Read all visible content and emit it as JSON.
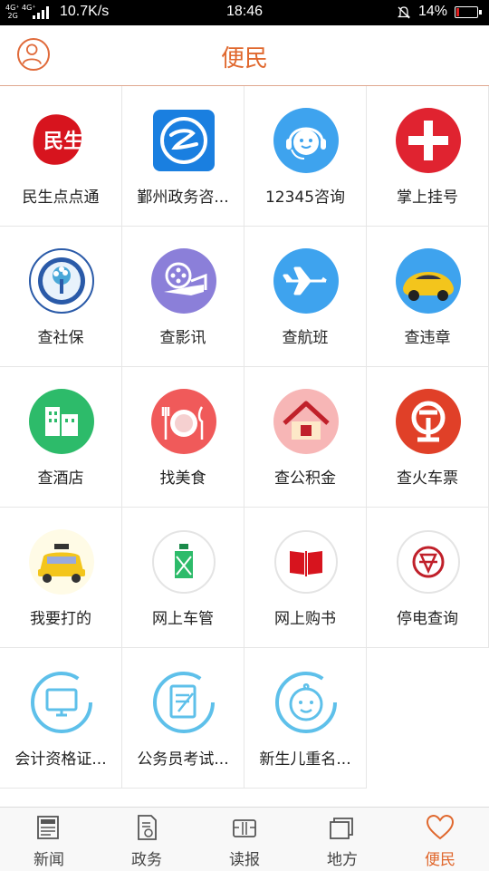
{
  "status_bar": {
    "network": "4G⁺ 4G⁺\n2G",
    "speed": "10.7K/s",
    "time": "18:46",
    "battery": "14%"
  },
  "header": {
    "title": "便民"
  },
  "services": [
    {
      "label": "民生点点通",
      "icon": "minsheng-logo-icon"
    },
    {
      "label": "鄞州政务咨...",
      "icon": "government-consult-icon"
    },
    {
      "label": "12345咨询",
      "icon": "headset-robot-icon"
    },
    {
      "label": "掌上挂号",
      "icon": "medical-cross-icon"
    },
    {
      "label": "查社保",
      "icon": "social-security-seal-icon"
    },
    {
      "label": "查影讯",
      "icon": "film-reel-icon"
    },
    {
      "label": "查航班",
      "icon": "airplane-icon"
    },
    {
      "label": "查违章",
      "icon": "yellow-car-icon"
    },
    {
      "label": "查酒店",
      "icon": "hotel-building-icon"
    },
    {
      "label": "找美食",
      "icon": "dining-plate-icon"
    },
    {
      "label": "查公积金",
      "icon": "house-icon"
    },
    {
      "label": "查火车票",
      "icon": "railway-logo-icon"
    },
    {
      "label": "我要打的",
      "icon": "taxi-icon"
    },
    {
      "label": "网上车管",
      "icon": "traffic-police-icon"
    },
    {
      "label": "网上购书",
      "icon": "book-icon"
    },
    {
      "label": "停电查询",
      "icon": "power-grid-icon"
    },
    {
      "label": "会计资格证...",
      "icon": "computer-monitor-icon"
    },
    {
      "label": "公务员考试...",
      "icon": "exam-document-icon"
    },
    {
      "label": "新生儿重名...",
      "icon": "baby-face-icon"
    }
  ],
  "tabs": [
    {
      "label": "新闻",
      "icon": "newspaper-icon"
    },
    {
      "label": "政务",
      "icon": "government-document-icon"
    },
    {
      "label": "读报",
      "icon": "reading-icon"
    },
    {
      "label": "地方",
      "icon": "stacked-pages-icon"
    },
    {
      "label": "便民",
      "icon": "heart-icon",
      "active": true
    }
  ],
  "colors": {
    "accent": "#e0682e"
  }
}
